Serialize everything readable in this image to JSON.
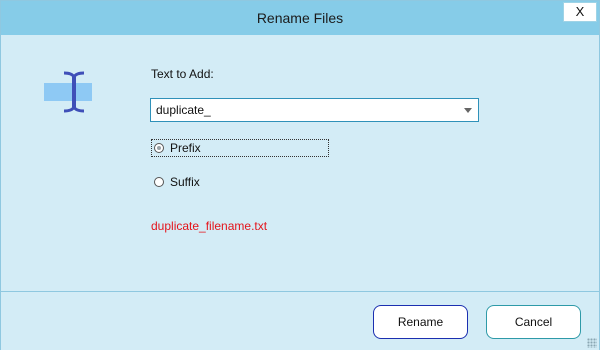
{
  "window": {
    "title": "Rename Files",
    "close_label": "X"
  },
  "form": {
    "text_label": "Text to Add:",
    "combo_value": "duplicate_",
    "options": [
      {
        "label": "Prefix",
        "selected": true
      },
      {
        "label": "Suffix",
        "selected": false
      }
    ],
    "preview": "duplicate_filename.txt"
  },
  "footer": {
    "rename_label": "Rename",
    "cancel_label": "Cancel"
  },
  "colors": {
    "titlebar": "#86cce8",
    "background": "#d3ecf6",
    "preview_text": "#e4141b",
    "icon_bar": "#8ec9f4",
    "icon_cursor": "#3f4fb8"
  },
  "icons": {
    "app_icon": "text-cursor-icon"
  }
}
